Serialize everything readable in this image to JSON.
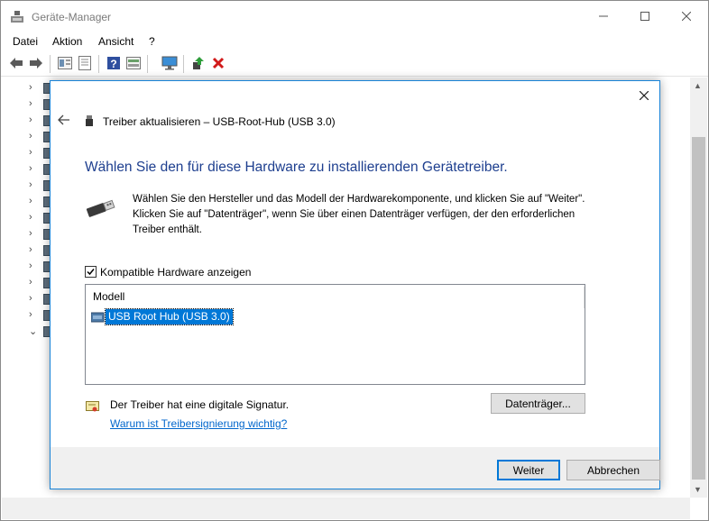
{
  "window": {
    "title": "Geräte-Manager",
    "icon": "device-manager-icon",
    "controls": {
      "minimize": "–",
      "maximize": "☐",
      "close": "✕"
    }
  },
  "menu": [
    "Datei",
    "Aktion",
    "Ansicht",
    "?"
  ],
  "toolbar": {
    "icons": [
      "back-arrow-icon",
      "forward-arrow-icon",
      "properties-icon",
      "tree-view-icon",
      "help-icon",
      "device-view-icon",
      "monitor-icon",
      "update-driver-icon",
      "uninstall-icon"
    ]
  },
  "tree": {
    "expand_glyph": "›",
    "collapse_glyph": "⌄"
  },
  "dialog": {
    "close_glyph": "✕",
    "header": "Treiber aktualisieren – USB-Root-Hub (USB 3.0)",
    "heading": "Wählen Sie den für diese Hardware zu installierenden Gerätetreiber.",
    "description": "Wählen Sie den Hersteller und das Modell der Hardwarekomponente, und klicken Sie auf \"Weiter\". Klicken Sie auf \"Datenträger\", wenn Sie über einen Datenträger verfügen, der den erforderlichen Treiber enthält.",
    "compat_checkbox": {
      "label": "Kompatible Hardware anzeigen",
      "checked": true
    },
    "model_list": {
      "header": "Modell",
      "items": [
        {
          "label": "USB Root Hub (USB 3.0)",
          "selected": true
        }
      ]
    },
    "signature_text": "Der Treiber hat eine digitale Signatur.",
    "signature_link": "Warum ist Treibersignierung wichtig?",
    "disk_button": "Datenträger...",
    "next_button": "Weiter",
    "cancel_button": "Abbrechen"
  },
  "colors": {
    "dialog_border": "#1883d7",
    "heading": "#1e3f8f",
    "selection": "#0078d7",
    "link": "#0066cc"
  }
}
